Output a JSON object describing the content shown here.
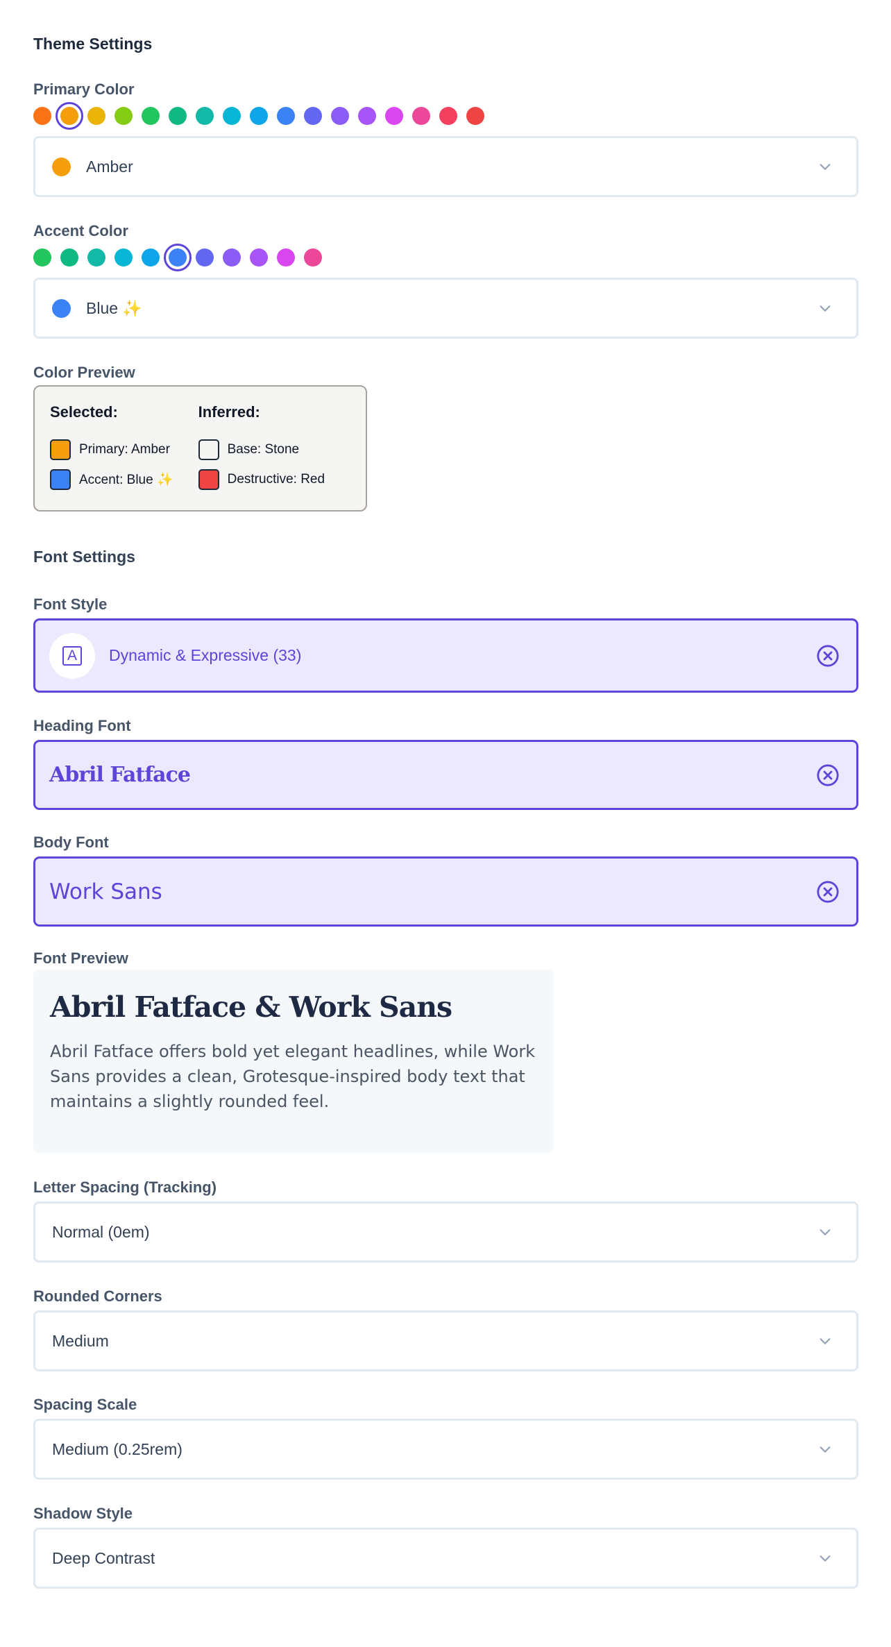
{
  "theme": {
    "title": "Theme Settings",
    "primary": {
      "label": "Primary Color",
      "swatches": [
        "#f97316",
        "#f59e0b",
        "#eab308",
        "#84cc16",
        "#22c55e",
        "#10b981",
        "#14b8a6",
        "#06b6d4",
        "#0ea5e9",
        "#3b82f6",
        "#6366f1",
        "#8b5cf6",
        "#a855f7",
        "#d946ef",
        "#ec4899",
        "#f43f5e",
        "#ef4444"
      ],
      "selected_index": 1,
      "value": "Amber",
      "value_color": "#f59e0b"
    },
    "accent": {
      "label": "Accent Color",
      "swatches": [
        "#22c55e",
        "#10b981",
        "#14b8a6",
        "#06b6d4",
        "#0ea5e9",
        "#3b82f6",
        "#6366f1",
        "#8b5cf6",
        "#a855f7",
        "#d946ef",
        "#ec4899"
      ],
      "selected_index": 5,
      "value": "Blue ✨",
      "value_color": "#3b82f6"
    },
    "preview": {
      "label": "Color Preview",
      "selected_heading": "Selected:",
      "inferred_heading": "Inferred:",
      "primary_text": "Primary: Amber",
      "accent_text": "Accent: Blue ✨",
      "base_text": "Base: Stone",
      "destructive_text": "Destructive: Red",
      "primary_color": "#f59e0b",
      "accent_color": "#3b82f6",
      "base_color": "#f5f5f4",
      "destructive_color": "#ef4444"
    }
  },
  "fonts": {
    "title": "Font Settings",
    "style_label": "Font Style",
    "style_value": "Dynamic & Expressive (33)",
    "heading_label": "Heading Font",
    "heading_value": "Abril Fatface",
    "body_label": "Body Font",
    "body_value": "Work Sans",
    "preview_label": "Font Preview",
    "preview_heading": "Abril Fatface & Work Sans",
    "preview_text": "Abril Fatface offers bold yet elegant headlines, while Work Sans provides a clean, Grotesque-inspired body text that maintains a slightly rounded feel."
  },
  "selects": {
    "tracking_label": "Letter Spacing (Tracking)",
    "tracking_value": "Normal (0em)",
    "corners_label": "Rounded Corners",
    "corners_value": "Medium",
    "spacing_label": "Spacing Scale",
    "spacing_value": "Medium (0.25rem)",
    "shadow_label": "Shadow Style",
    "shadow_value": "Deep Contrast"
  },
  "icons": {
    "chevron": "chevron-down-icon",
    "clear": "clear-circle-icon",
    "font": "font-a-icon"
  },
  "accent_ui": "#5b46d9"
}
